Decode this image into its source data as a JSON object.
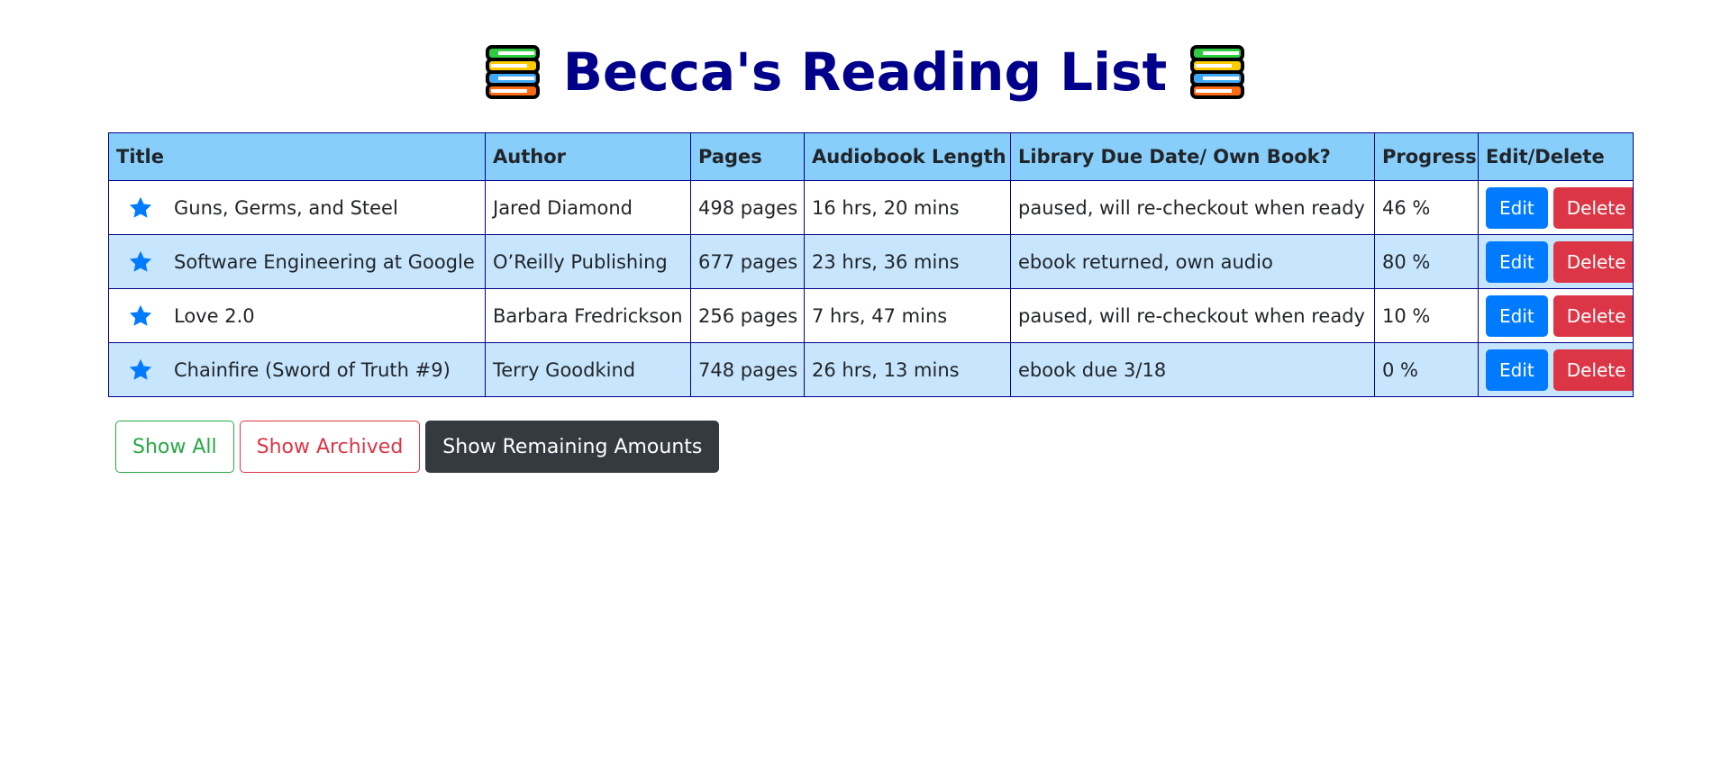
{
  "header": {
    "title": "Becca's Reading List",
    "icon_left": "books-icon",
    "icon_right": "books-icon"
  },
  "table": {
    "columns": [
      "Title",
      "Author",
      "Pages",
      "Audiobook Length",
      "Library Due Date/ Own Book?",
      "Progress",
      "Edit/Delete"
    ],
    "rows": [
      {
        "icon": "star-icon",
        "title": "Guns, Germs, and Steel",
        "author": "Jared Diamond",
        "pages": "498 pages",
        "audio": "16 hrs, 20 mins",
        "due": "paused, will re-checkout when ready",
        "progress": "46 %",
        "edit": "Edit",
        "delete": "Delete"
      },
      {
        "icon": "star-icon",
        "title": "Software Engineering at Google",
        "author": "O’Reilly Publishing",
        "pages": "677 pages",
        "audio": "23 hrs, 36 mins",
        "due": "ebook returned, own audio",
        "progress": "80 %",
        "edit": "Edit",
        "delete": "Delete"
      },
      {
        "icon": "star-icon",
        "title": "Love 2.0",
        "author": "Barbara Fredrickson",
        "pages": "256 pages",
        "audio": "7 hrs, 47 mins",
        "due": "paused, will re-checkout when ready",
        "progress": "10 %",
        "edit": "Edit",
        "delete": "Delete"
      },
      {
        "icon": "star-icon",
        "title": "Chainfire (Sword of Truth #9)",
        "author": "Terry Goodkind",
        "pages": "748 pages",
        "audio": "26 hrs, 13 mins",
        "due": "ebook due 3/18",
        "progress": "0 %",
        "edit": "Edit",
        "delete": "Delete"
      }
    ]
  },
  "toolbar": {
    "show_all": "Show All",
    "show_archived": "Show Archived",
    "show_remaining": "Show Remaining Amounts"
  },
  "colors": {
    "title": "#00008b",
    "header_bg": "#87cefa",
    "row_alt_bg": "#c7e5fd",
    "border": "#00008b",
    "star": "#007bff",
    "edit": "#007bff",
    "delete": "#dc3545",
    "show_all": "#28a745",
    "show_archived": "#dc3545",
    "show_remaining": "#343a40"
  }
}
